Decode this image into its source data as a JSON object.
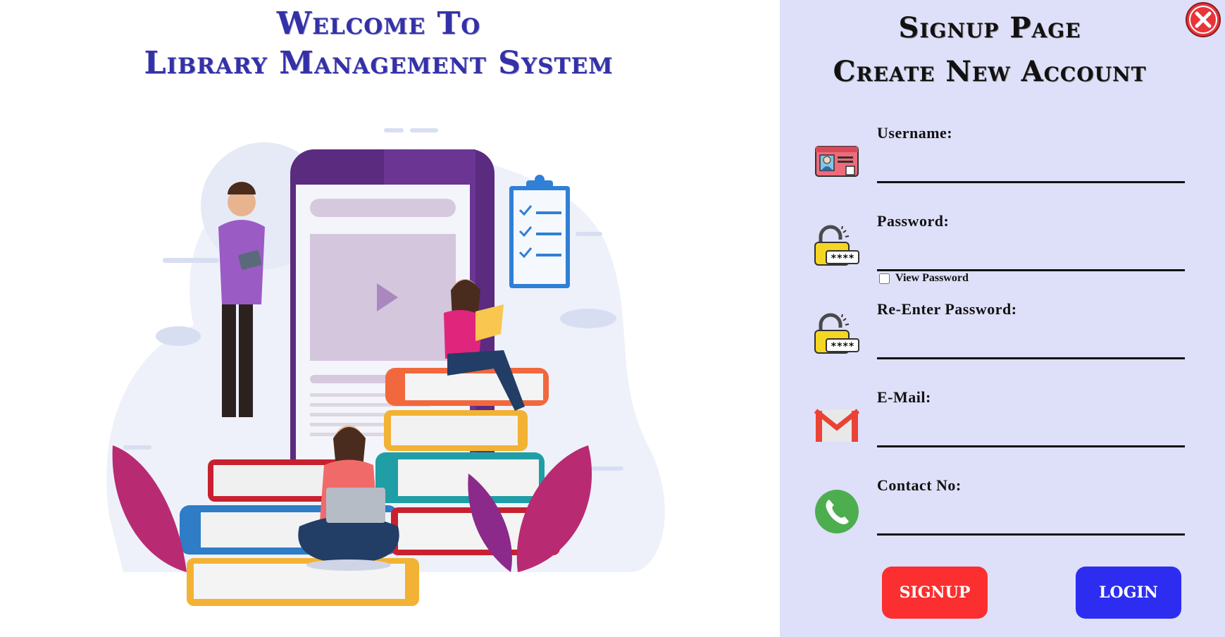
{
  "welcome": {
    "line1": "Welcome To",
    "line2": "Library Management System"
  },
  "signup": {
    "title_line1": "Signup Page",
    "title_line2": "Create New Account",
    "fields": [
      {
        "label": "Username:",
        "value": "",
        "icon": "id-card-icon"
      },
      {
        "label": "Password:",
        "value": "",
        "icon": "padlock-icon"
      },
      {
        "label": "Re-Enter Password:",
        "value": "",
        "icon": "padlock-icon"
      },
      {
        "label": "E-Mail:",
        "value": "",
        "icon": "gmail-icon"
      },
      {
        "label": "Contact No:",
        "value": "",
        "icon": "phone-icon"
      }
    ],
    "view_password_label": "View Password",
    "signup_button": "SIGNUP",
    "login_button": "LOGIN"
  },
  "colors": {
    "welcome_text": "#3431a8",
    "right_panel_bg": "#dedff8",
    "signup_button": "#fb2f2f",
    "login_button": "#2d2df1"
  }
}
